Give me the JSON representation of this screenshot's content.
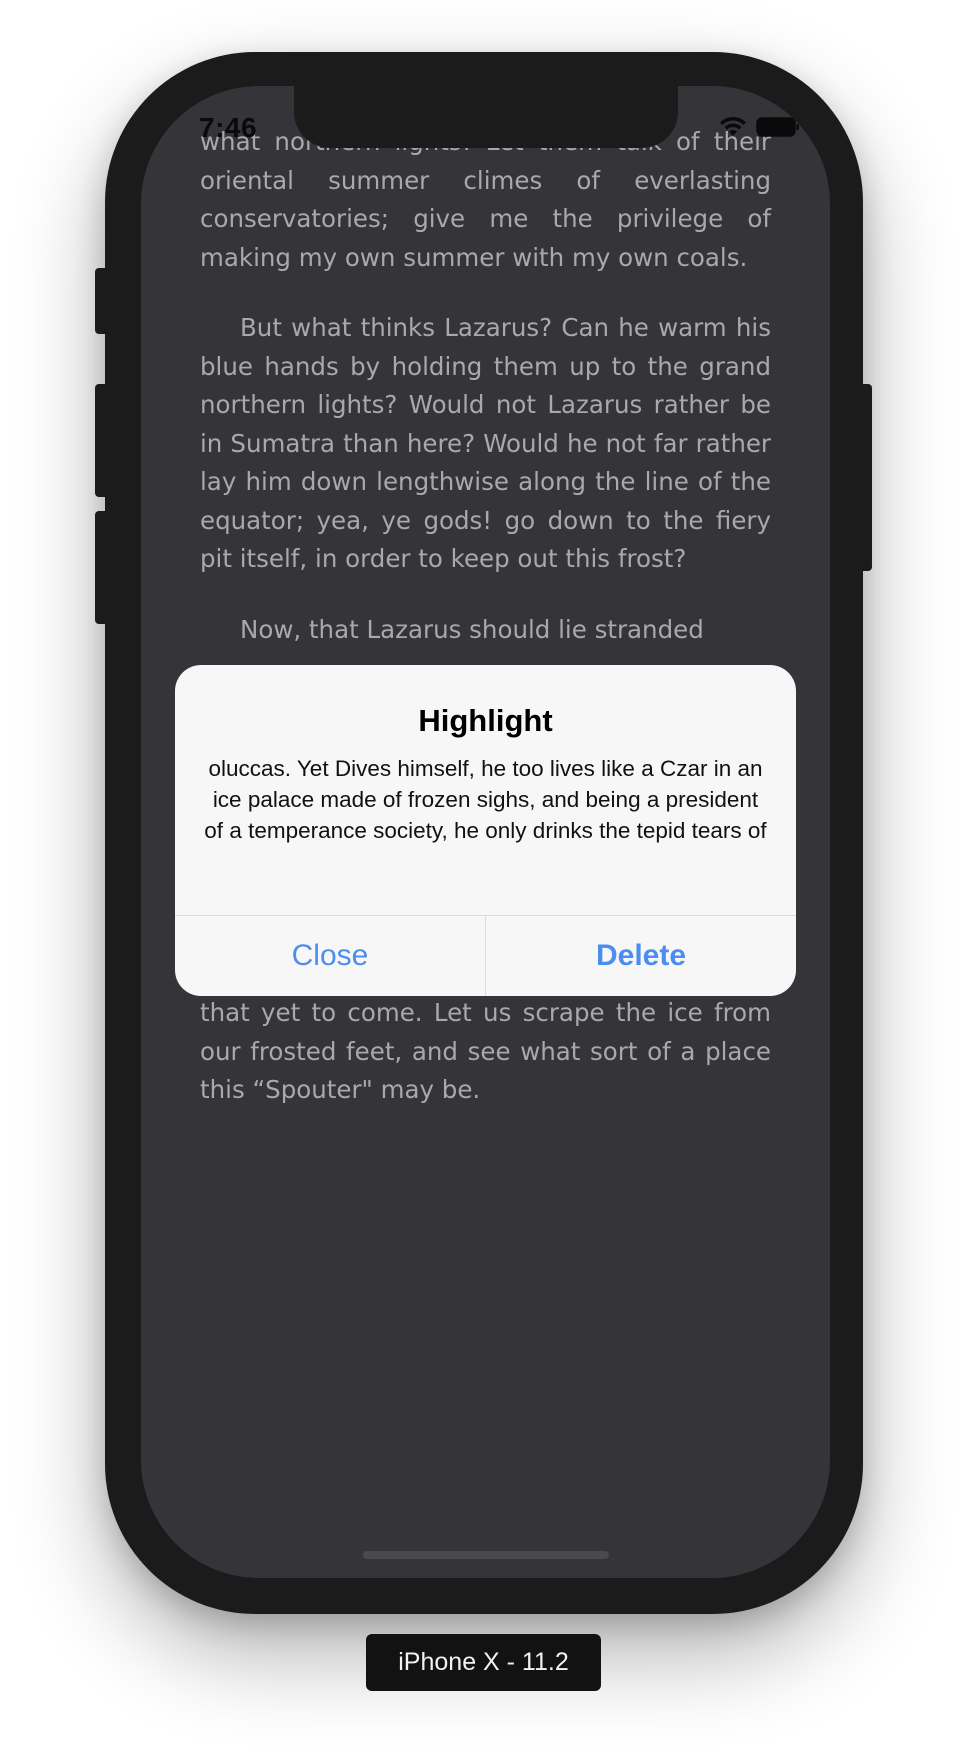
{
  "status_bar": {
    "time": "7:46",
    "wifi_icon": "wifi-icon",
    "battery_icon": "battery-icon"
  },
  "book": {
    "paragraphs": [
      "what northern lights! Let them talk of their oriental summer climes of everlasting conservatories; give me the privilege of making my own summer with my own coals.",
      "But what thinks Lazarus? Can he warm his blue hands by holding them up to the grand northern lights? Would not Lazarus rather be in Sumatra than here? Would he not far rather lay him down lengthwise along the line of the equator; yea, ye gods! go down to the fiery pit itself, in order to keep out this frost?",
      "Now, that Lazarus should lie stranded",
      "But no more of this blubbering now, we are going a-whaling, and there is plenty of that yet to come. Let us scrape the ice from our frosted feet, and see what sort of a place this “Spouter\" may be."
    ]
  },
  "alert": {
    "title": "Highlight",
    "message": "oluccas. Yet Dives himself, he too lives like a Czar in an ice palace made of frozen sighs, and being a president of a temperance society, he only drinks the tepid tears of",
    "close_label": "Close",
    "delete_label": "Delete",
    "accent_color": "#4b8ef0"
  },
  "device_label": "iPhone X - 11.2"
}
